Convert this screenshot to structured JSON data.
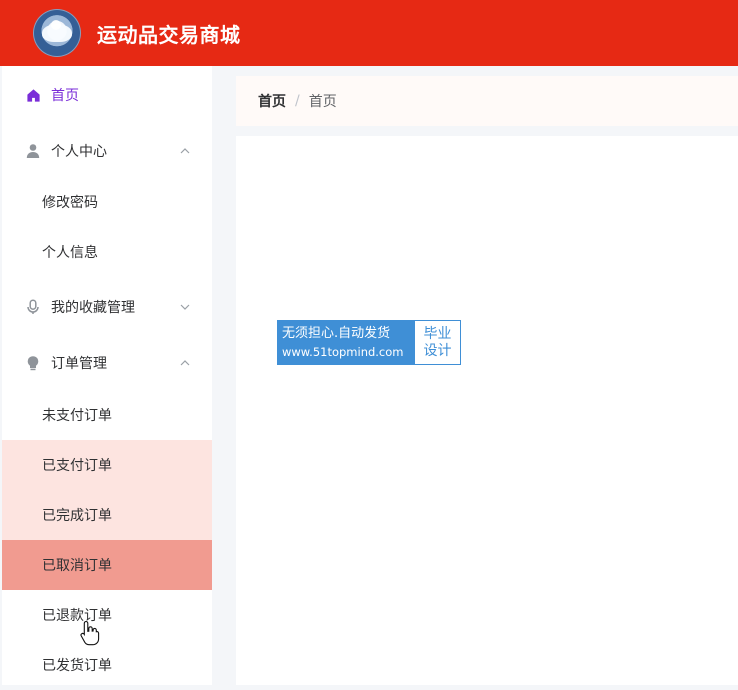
{
  "app": {
    "title": "运动品交易商城"
  },
  "sidebar": {
    "home": {
      "label": "首页",
      "icon": "home-icon",
      "color": "#7a2dd8"
    },
    "groups": [
      {
        "label": "个人中心",
        "icon": "user-icon",
        "expanded": true,
        "items": [
          {
            "label": "修改密码"
          },
          {
            "label": "个人信息"
          }
        ]
      },
      {
        "label": "我的收藏管理",
        "icon": "microphone-icon",
        "expanded": false,
        "items": []
      },
      {
        "label": "订单管理",
        "icon": "lightbulb-icon",
        "expanded": true,
        "items": [
          {
            "label": "未支付订单"
          },
          {
            "label": "已支付订单"
          },
          {
            "label": "已完成订单"
          },
          {
            "label": "已取消订单",
            "active": true
          },
          {
            "label": "已退款订单"
          },
          {
            "label": "已发货订单"
          }
        ]
      }
    ]
  },
  "breadcrumb": {
    "first": "首页",
    "separator": "/",
    "current": "首页"
  },
  "watermark": {
    "line1": "无须担心.自动发货",
    "line2": "www.51topmind.com",
    "right_line1": "毕业",
    "right_line2": "设计"
  },
  "colors": {
    "header": "#e62914",
    "active_item": "#f19b90",
    "hover_item": "#fde4e0",
    "watermark_blue": "#3f8fd6"
  }
}
